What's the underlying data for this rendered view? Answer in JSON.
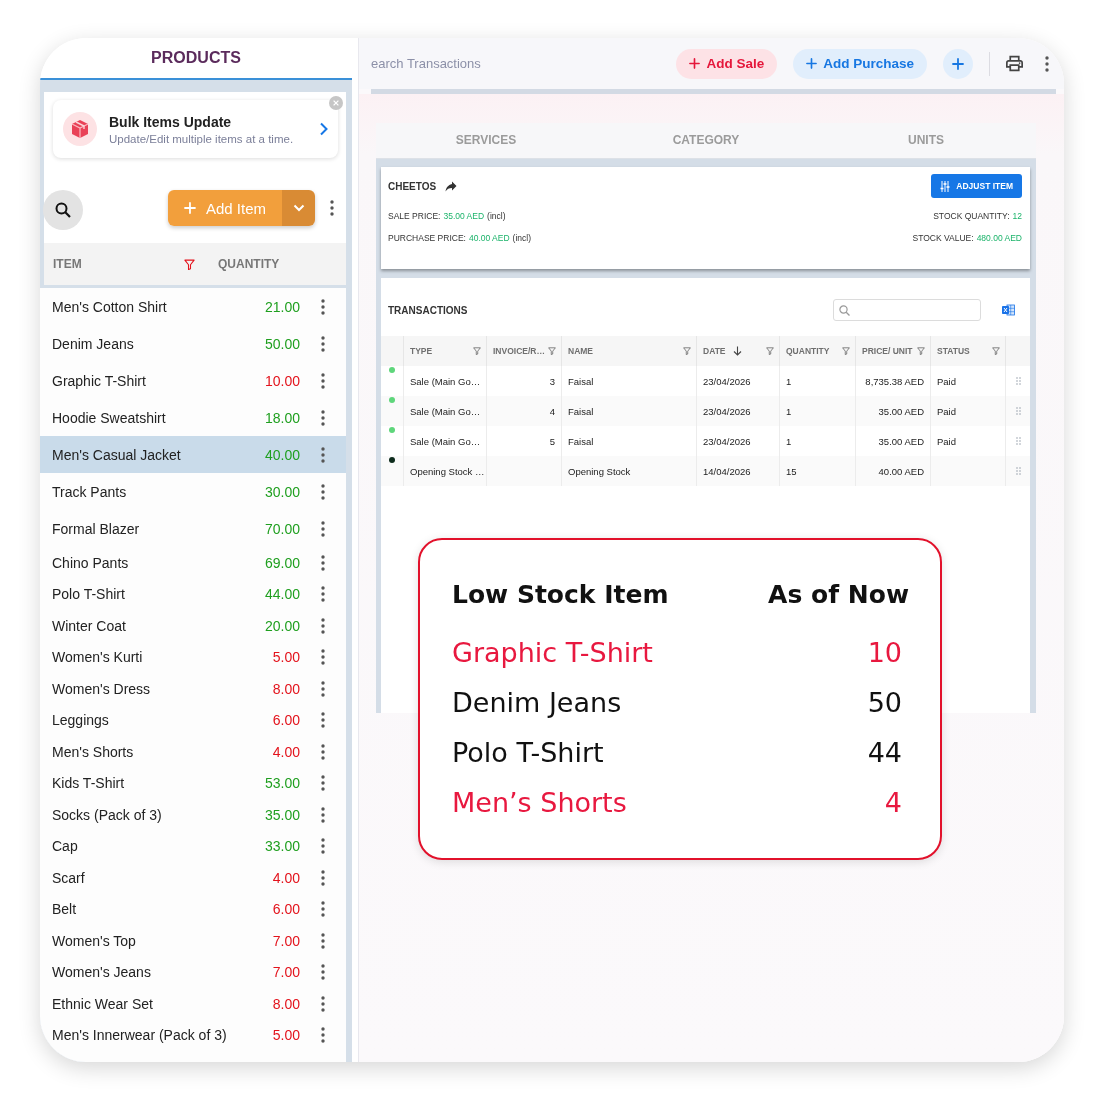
{
  "products_panel": {
    "title": "PRODUCTS",
    "bulk_update": {
      "title": "Bulk Items Update",
      "subtitle": "Update/Edit multiple items at a time."
    },
    "add_item_button": "Add Item",
    "columns": [
      "ITEM",
      "QUANTITY"
    ],
    "items": [
      {
        "name": "Men's Cotton Shirt",
        "quantity": "21.00",
        "low_stock": false,
        "selected": false
      },
      {
        "name": "Denim Jeans",
        "quantity": "50.00",
        "low_stock": false,
        "selected": false
      },
      {
        "name": "Graphic T-Shirt",
        "quantity": "10.00",
        "low_stock": true,
        "selected": false
      },
      {
        "name": "Hoodie Sweatshirt",
        "quantity": "18.00",
        "low_stock": false,
        "selected": false
      },
      {
        "name": "Men's Casual Jacket",
        "quantity": "40.00",
        "low_stock": false,
        "selected": true
      },
      {
        "name": "Track Pants",
        "quantity": "30.00",
        "low_stock": false,
        "selected": false
      },
      {
        "name": "Formal Blazer",
        "quantity": "70.00",
        "low_stock": false,
        "selected": false
      },
      {
        "name": "Chino Pants",
        "quantity": "69.00",
        "low_stock": false,
        "selected": false
      },
      {
        "name": "Polo T-Shirt",
        "quantity": "44.00",
        "low_stock": false,
        "selected": false
      },
      {
        "name": "Winter Coat",
        "quantity": "20.00",
        "low_stock": false,
        "selected": false
      },
      {
        "name": "Women's Kurti",
        "quantity": "5.00",
        "low_stock": true,
        "selected": false
      },
      {
        "name": "Women's Dress",
        "quantity": "8.00",
        "low_stock": true,
        "selected": false
      },
      {
        "name": "Leggings",
        "quantity": "6.00",
        "low_stock": true,
        "selected": false
      },
      {
        "name": "Men's Shorts",
        "quantity": "4.00",
        "low_stock": true,
        "selected": false
      },
      {
        "name": "Kids T-Shirt",
        "quantity": "53.00",
        "low_stock": false,
        "selected": false
      },
      {
        "name": "Socks (Pack of 3)",
        "quantity": "35.00",
        "low_stock": false,
        "selected": false
      },
      {
        "name": "Cap",
        "quantity": "33.00",
        "low_stock": false,
        "selected": false
      },
      {
        "name": "Scarf",
        "quantity": "4.00",
        "low_stock": true,
        "selected": false
      },
      {
        "name": "Belt",
        "quantity": "6.00",
        "low_stock": true,
        "selected": false
      },
      {
        "name": "Women's Top",
        "quantity": "7.00",
        "low_stock": true,
        "selected": false
      },
      {
        "name": "Women's Jeans",
        "quantity": "7.00",
        "low_stock": true,
        "selected": false
      },
      {
        "name": "Ethnic Wear Set",
        "quantity": "8.00",
        "low_stock": true,
        "selected": false
      },
      {
        "name": "Men's Innerwear (Pack of 3)",
        "quantity": "5.00",
        "low_stock": true,
        "selected": false
      }
    ]
  },
  "toolbar": {
    "search_placeholder": "earch Transactions",
    "buttons": [
      {
        "label": "Add Sale",
        "kind": "sale"
      },
      {
        "label": "Add Purchase",
        "kind": "purchase"
      }
    ]
  },
  "tabs": [
    {
      "label": "SERVICES",
      "selected": false
    },
    {
      "label": "CATEGORY",
      "selected": false
    },
    {
      "label": "UNITS",
      "selected": false
    }
  ],
  "item_card": {
    "name": "CHEETOS",
    "adjust_button": "ADJUST ITEM",
    "details": [
      {
        "label": "SALE PRICE:",
        "value": "35.00 AED",
        "note": "(incl)"
      },
      {
        "label": "STOCK QUANTITY:",
        "value": "12"
      },
      {
        "label": "PURCHASE PRICE:",
        "value": "40.00 AED",
        "note": "(incl)"
      },
      {
        "label": "STOCK VALUE:",
        "value": "480.00 AED"
      }
    ]
  },
  "transactions": {
    "title": "TRANSACTIONS",
    "columns": [
      {
        "label": "TYPE",
        "sorted": false
      },
      {
        "label": "INVOICE/R…",
        "sorted": false
      },
      {
        "label": "NAME",
        "sorted": false
      },
      {
        "label": "DATE",
        "sorted": true
      },
      {
        "label": "QUANTITY",
        "sorted": false
      },
      {
        "label": "PRICE/ UNIT",
        "sorted": false
      },
      {
        "label": "STATUS",
        "sorted": false
      }
    ],
    "rows": [
      {
        "color": "#5ed67b",
        "type": "Sale (Main Go…",
        "invoice": "3",
        "name": "Faisal",
        "date": "23/04/2026",
        "quantity": "1",
        "price": "8,735.38 AED",
        "status": "Paid"
      },
      {
        "color": "#5ed67b",
        "type": "Sale (Main Go…",
        "invoice": "4",
        "name": "Faisal",
        "date": "23/04/2026",
        "quantity": "1",
        "price": "35.00 AED",
        "status": "Paid"
      },
      {
        "color": "#5ed67b",
        "type": "Sale (Main Go…",
        "invoice": "5",
        "name": "Faisal",
        "date": "23/04/2026",
        "quantity": "1",
        "price": "35.00 AED",
        "status": "Paid"
      },
      {
        "color": "#0d2b1c",
        "type": "Opening Stock …",
        "name": "Opening Stock",
        "date": "14/04/2026",
        "quantity": "15",
        "price": "40.00 AED"
      }
    ]
  },
  "low_stock_card": {
    "headers": [
      "Low Stock Item",
      "As of Now"
    ],
    "rows": [
      {
        "name": "Graphic T-Shirt",
        "quantity": "10",
        "low": true
      },
      {
        "name": "Denim Jeans",
        "quantity": "50",
        "low": false
      },
      {
        "name": "Polo T-Shirt",
        "quantity": "44",
        "low": false
      },
      {
        "name": "Men’s Shorts",
        "quantity": "4",
        "low": true
      }
    ]
  }
}
